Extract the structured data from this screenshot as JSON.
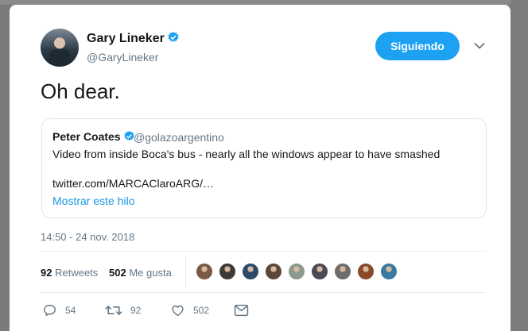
{
  "tweet": {
    "author_name": "Gary Lineker",
    "author_handle": "@GaryLineker",
    "follow_label": "Siguiendo",
    "text": "Oh dear.",
    "timestamp": "14:50 - 24 nov. 2018"
  },
  "quoted_tweet": {
    "author_name": "Peter Coates",
    "author_handle": "@golazoargentino",
    "text": "Video from inside Boca's bus - nearly all the windows appear to have smashed",
    "link": "twitter.com/MARCAClaroARG/…",
    "thread_label": "Mostrar este hilo"
  },
  "stats": {
    "retweets_count": "92",
    "retweets_label": "Retweets",
    "likes_count": "502",
    "likes_label": "Me gusta"
  },
  "actions": {
    "reply_count": "54",
    "retweet_count": "92",
    "like_count": "502"
  },
  "icons": [
    "verified-icon",
    "chevron-down-icon",
    "reply-icon",
    "retweet-icon",
    "heart-icon",
    "message-icon"
  ],
  "colors": {
    "accent": "#1da1f2",
    "link": "#1b95e0",
    "secondary_text": "#657786",
    "border": "#e1e8ed"
  },
  "liker_avatar_colors": [
    "#7a5a44",
    "#3d3a36",
    "#2d4a6a",
    "#5e4638",
    "#8a9a8c",
    "#4a4a52",
    "#6d6d6d",
    "#8a4a2a",
    "#3b7aa0"
  ]
}
